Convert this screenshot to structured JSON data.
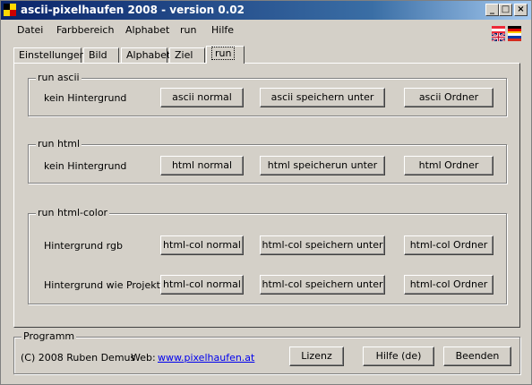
{
  "window": {
    "title": "ascii-pixelhaufen 2008 - version 0.02",
    "controls": {
      "minimize": "_",
      "maximize": "□",
      "close": "×"
    }
  },
  "menu": [
    "Datei",
    "Farbbereich",
    "Alphabet",
    "run",
    "Hilfe"
  ],
  "tabs": [
    "Einstellungen",
    "Bild",
    "Alphabet",
    "Ziel",
    "run"
  ],
  "active_tab": "run",
  "groups": {
    "ascii": {
      "legend": "run ascii",
      "label": "kein Hintergrund",
      "buttons": [
        "ascii normal",
        "ascii speichern unter",
        "ascii Ordner"
      ]
    },
    "html": {
      "legend": "run html",
      "label": "kein Hintergrund",
      "buttons": [
        "html normal",
        "html speicherun unter",
        "html Ordner"
      ]
    },
    "htmlcolor": {
      "legend": "run html-color",
      "rows": [
        {
          "label": "Hintergrund rgb",
          "buttons": [
            "html-col normal",
            "html-col speichern unter",
            "html-col Ordner"
          ]
        },
        {
          "label": "Hintergrund wie Projekt",
          "buttons": [
            "html-col normal",
            "html-col speichern unter",
            "html-col Ordner"
          ]
        }
      ]
    }
  },
  "program": {
    "legend": "Programm",
    "copyright": "(C) 2008 Ruben Demus",
    "web_label": "Web:",
    "web_link": "www.pixelhaufen.at",
    "buttons": [
      "Lizenz",
      "Hilfe (de)",
      "Beenden"
    ]
  },
  "colors": {
    "title_start": "#0a246a",
    "title_end": "#a6caf0",
    "face": "#d4d0c8",
    "link": "#0000ee"
  }
}
